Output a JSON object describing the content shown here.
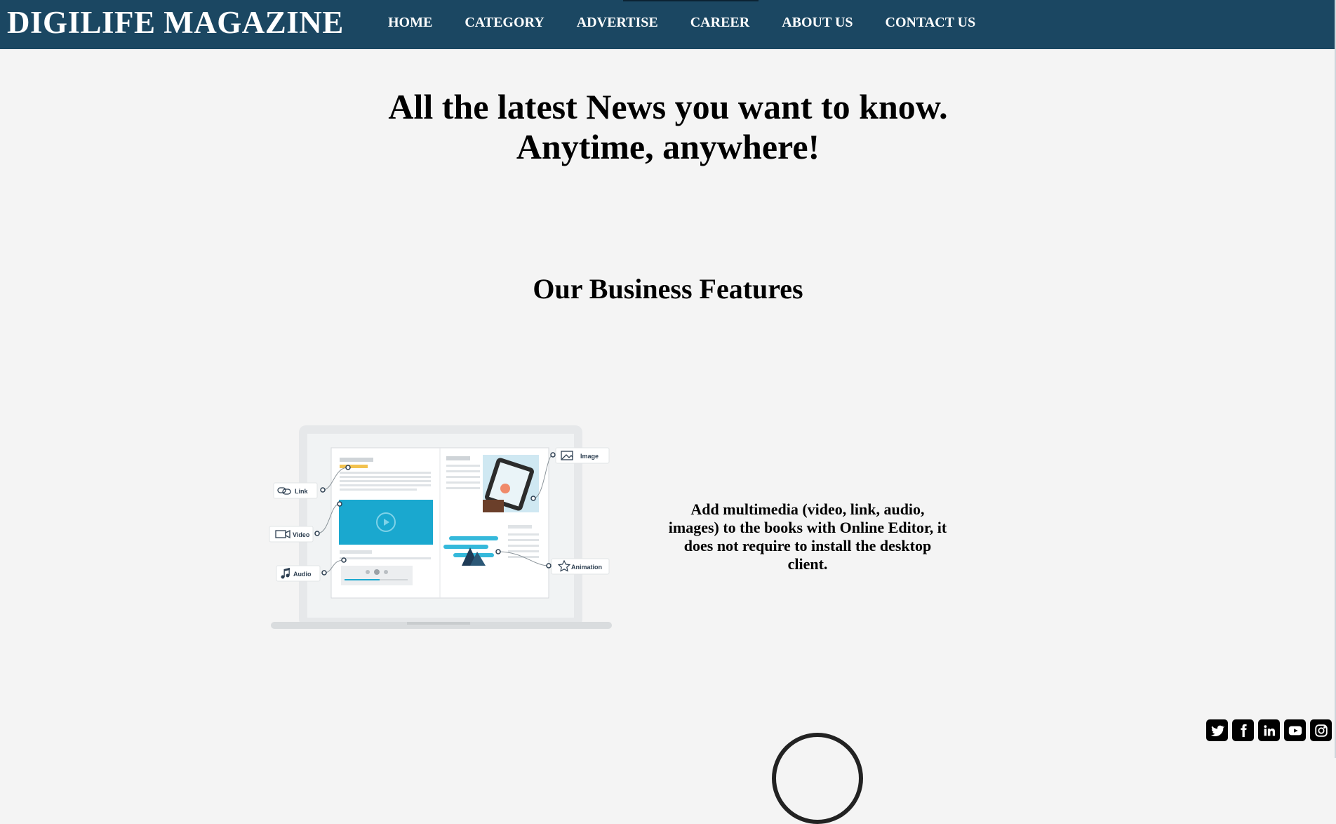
{
  "header": {
    "brand": "DIGILIFE MAGAZINE",
    "nav": [
      "HOME",
      "CATEGORY",
      "ADVERTISE",
      "CAREER",
      "ABOUT US",
      "CONTACT US"
    ]
  },
  "hero": {
    "line1": "All the latest News you want to know.",
    "line2": "Anytime, anywhere!"
  },
  "features": {
    "title": "Our Business Features",
    "description": "Add multimedia (video, link, audio, images) to the books with Online Editor, it does not require to install the desktop client.",
    "illustration_labels": {
      "link": "Link",
      "video": "Video",
      "audio": "Audio",
      "image": "Image",
      "animation": "Animation"
    }
  },
  "social": [
    "twitter-icon",
    "facebook-icon",
    "linkedin-icon",
    "youtube-icon",
    "instagram-icon"
  ],
  "colors": {
    "header_bg": "#1b4762",
    "page_bg": "#f4f4f4",
    "accent": "#1aa8cf"
  }
}
